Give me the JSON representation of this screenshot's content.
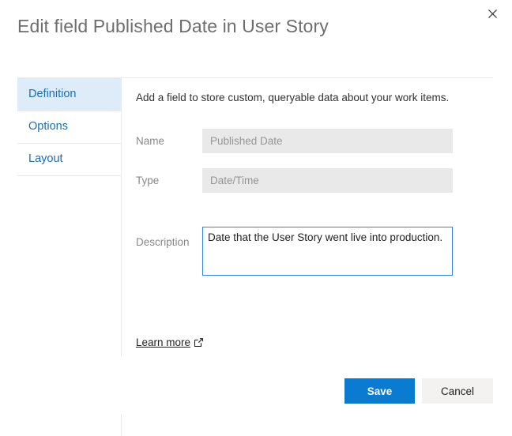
{
  "dialog": {
    "title": "Edit field Published Date in User Story",
    "close_icon": "close-icon",
    "intro": "Add a field to store custom, queryable data about your work items."
  },
  "sidebar": {
    "items": [
      {
        "label": "Definition",
        "selected": true
      },
      {
        "label": "Options",
        "selected": false
      },
      {
        "label": "Layout",
        "selected": false
      }
    ]
  },
  "form": {
    "name": {
      "label": "Name",
      "value": "Published Date",
      "placeholder": "Published Date"
    },
    "type": {
      "label": "Type",
      "value": "Date/Time",
      "placeholder": "Date/Time"
    },
    "description": {
      "label": "Description",
      "value": "Date that the User Story went live into production.",
      "placeholder": ""
    }
  },
  "links": {
    "learn_more": "Learn more",
    "learn_more_icon": "external-link-icon"
  },
  "footer": {
    "save_label": "Save",
    "cancel_label": "Cancel"
  },
  "colors": {
    "accent": "#0b7ad1",
    "selected_nav_bg": "#deecf9",
    "nav_text": "#1b6eb3",
    "focus_border": "#2b88d8",
    "disabled_input_bg": "#e9e9e9",
    "cancel_bg": "#f3f2f1",
    "title_text": "#6e6e6e",
    "divider": "#eaeaea"
  }
}
